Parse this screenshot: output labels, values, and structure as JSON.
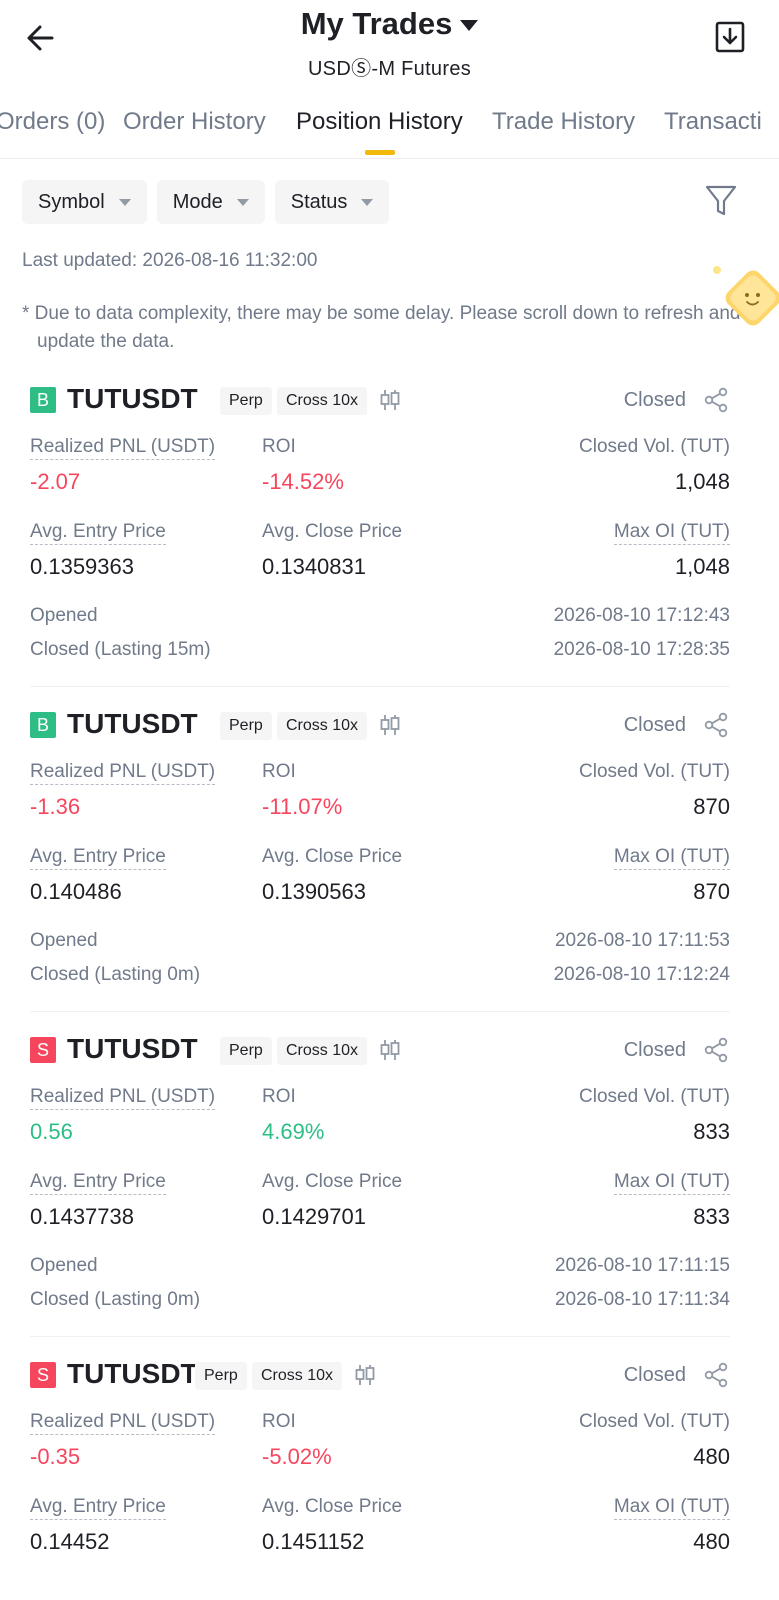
{
  "header": {
    "title": "My Trades",
    "subtitle": "USDⓈ-M Futures"
  },
  "tabs": [
    {
      "label": "Orders (0)"
    },
    {
      "label": "Order History"
    },
    {
      "label": "Position History",
      "active": true
    },
    {
      "label": "Trade History"
    },
    {
      "label": "Transacti"
    }
  ],
  "filters": {
    "symbol": "Symbol",
    "mode": "Mode",
    "status": "Status"
  },
  "last_updated": "Last updated: 2026-08-16 11:32:00",
  "notice": "* Due to data complexity, there may be some delay. Please scroll down to refresh and update the data.",
  "labels": {
    "realized_pnl": "Realized PNL (USDT)",
    "roi": "ROI",
    "closed_vol": "Closed Vol. (TUT)",
    "avg_entry": "Avg. Entry Price",
    "avg_close": "Avg. Close Price",
    "max_oi": "Max OI (TUT)",
    "opened": "Opened"
  },
  "positions": [
    {
      "side": "B",
      "symbol": "TUTUSDT",
      "type": "Perp",
      "margin": "Cross 10x",
      "status": "Closed",
      "pnl": "-2.07",
      "roi": "-14.52%",
      "closed_vol": "1,048",
      "entry": "0.1359363",
      "close": "0.1340831",
      "max_oi": "1,048",
      "opened": "2026-08-10 17:12:43",
      "closed_label": "Closed (Lasting 15m)",
      "closed": "2026-08-10 17:28:35"
    },
    {
      "side": "B",
      "symbol": "TUTUSDT",
      "type": "Perp",
      "margin": "Cross 10x",
      "status": "Closed",
      "pnl": "-1.36",
      "roi": "-11.07%",
      "closed_vol": "870",
      "entry": "0.140486",
      "close": "0.1390563",
      "max_oi": "870",
      "opened": "2026-08-10 17:11:53",
      "closed_label": "Closed (Lasting 0m)",
      "closed": "2026-08-10 17:12:24"
    },
    {
      "side": "S",
      "symbol": "TUTUSDT",
      "type": "Perp",
      "margin": "Cross 10x",
      "status": "Closed",
      "pnl": "0.56",
      "roi": "4.69%",
      "closed_vol": "833",
      "entry": "0.1437738",
      "close": "0.1429701",
      "max_oi": "833",
      "opened": "2026-08-10 17:11:15",
      "closed_label": "Closed (Lasting 0m)",
      "closed": "2026-08-10 17:11:34"
    },
    {
      "side": "S",
      "symbol": "TUTUSDT",
      "type": "Perp",
      "margin": "Cross 10x",
      "status": "Closed",
      "pnl": "-0.35",
      "roi": "-5.02%",
      "closed_vol": "480",
      "entry": "0.14452",
      "close": "0.1451152",
      "max_oi": "480"
    }
  ],
  "colors": {
    "accent": "#f0b90b",
    "buy": "#2ebd85",
    "sell": "#f6465d",
    "muted": "#707a8a"
  }
}
